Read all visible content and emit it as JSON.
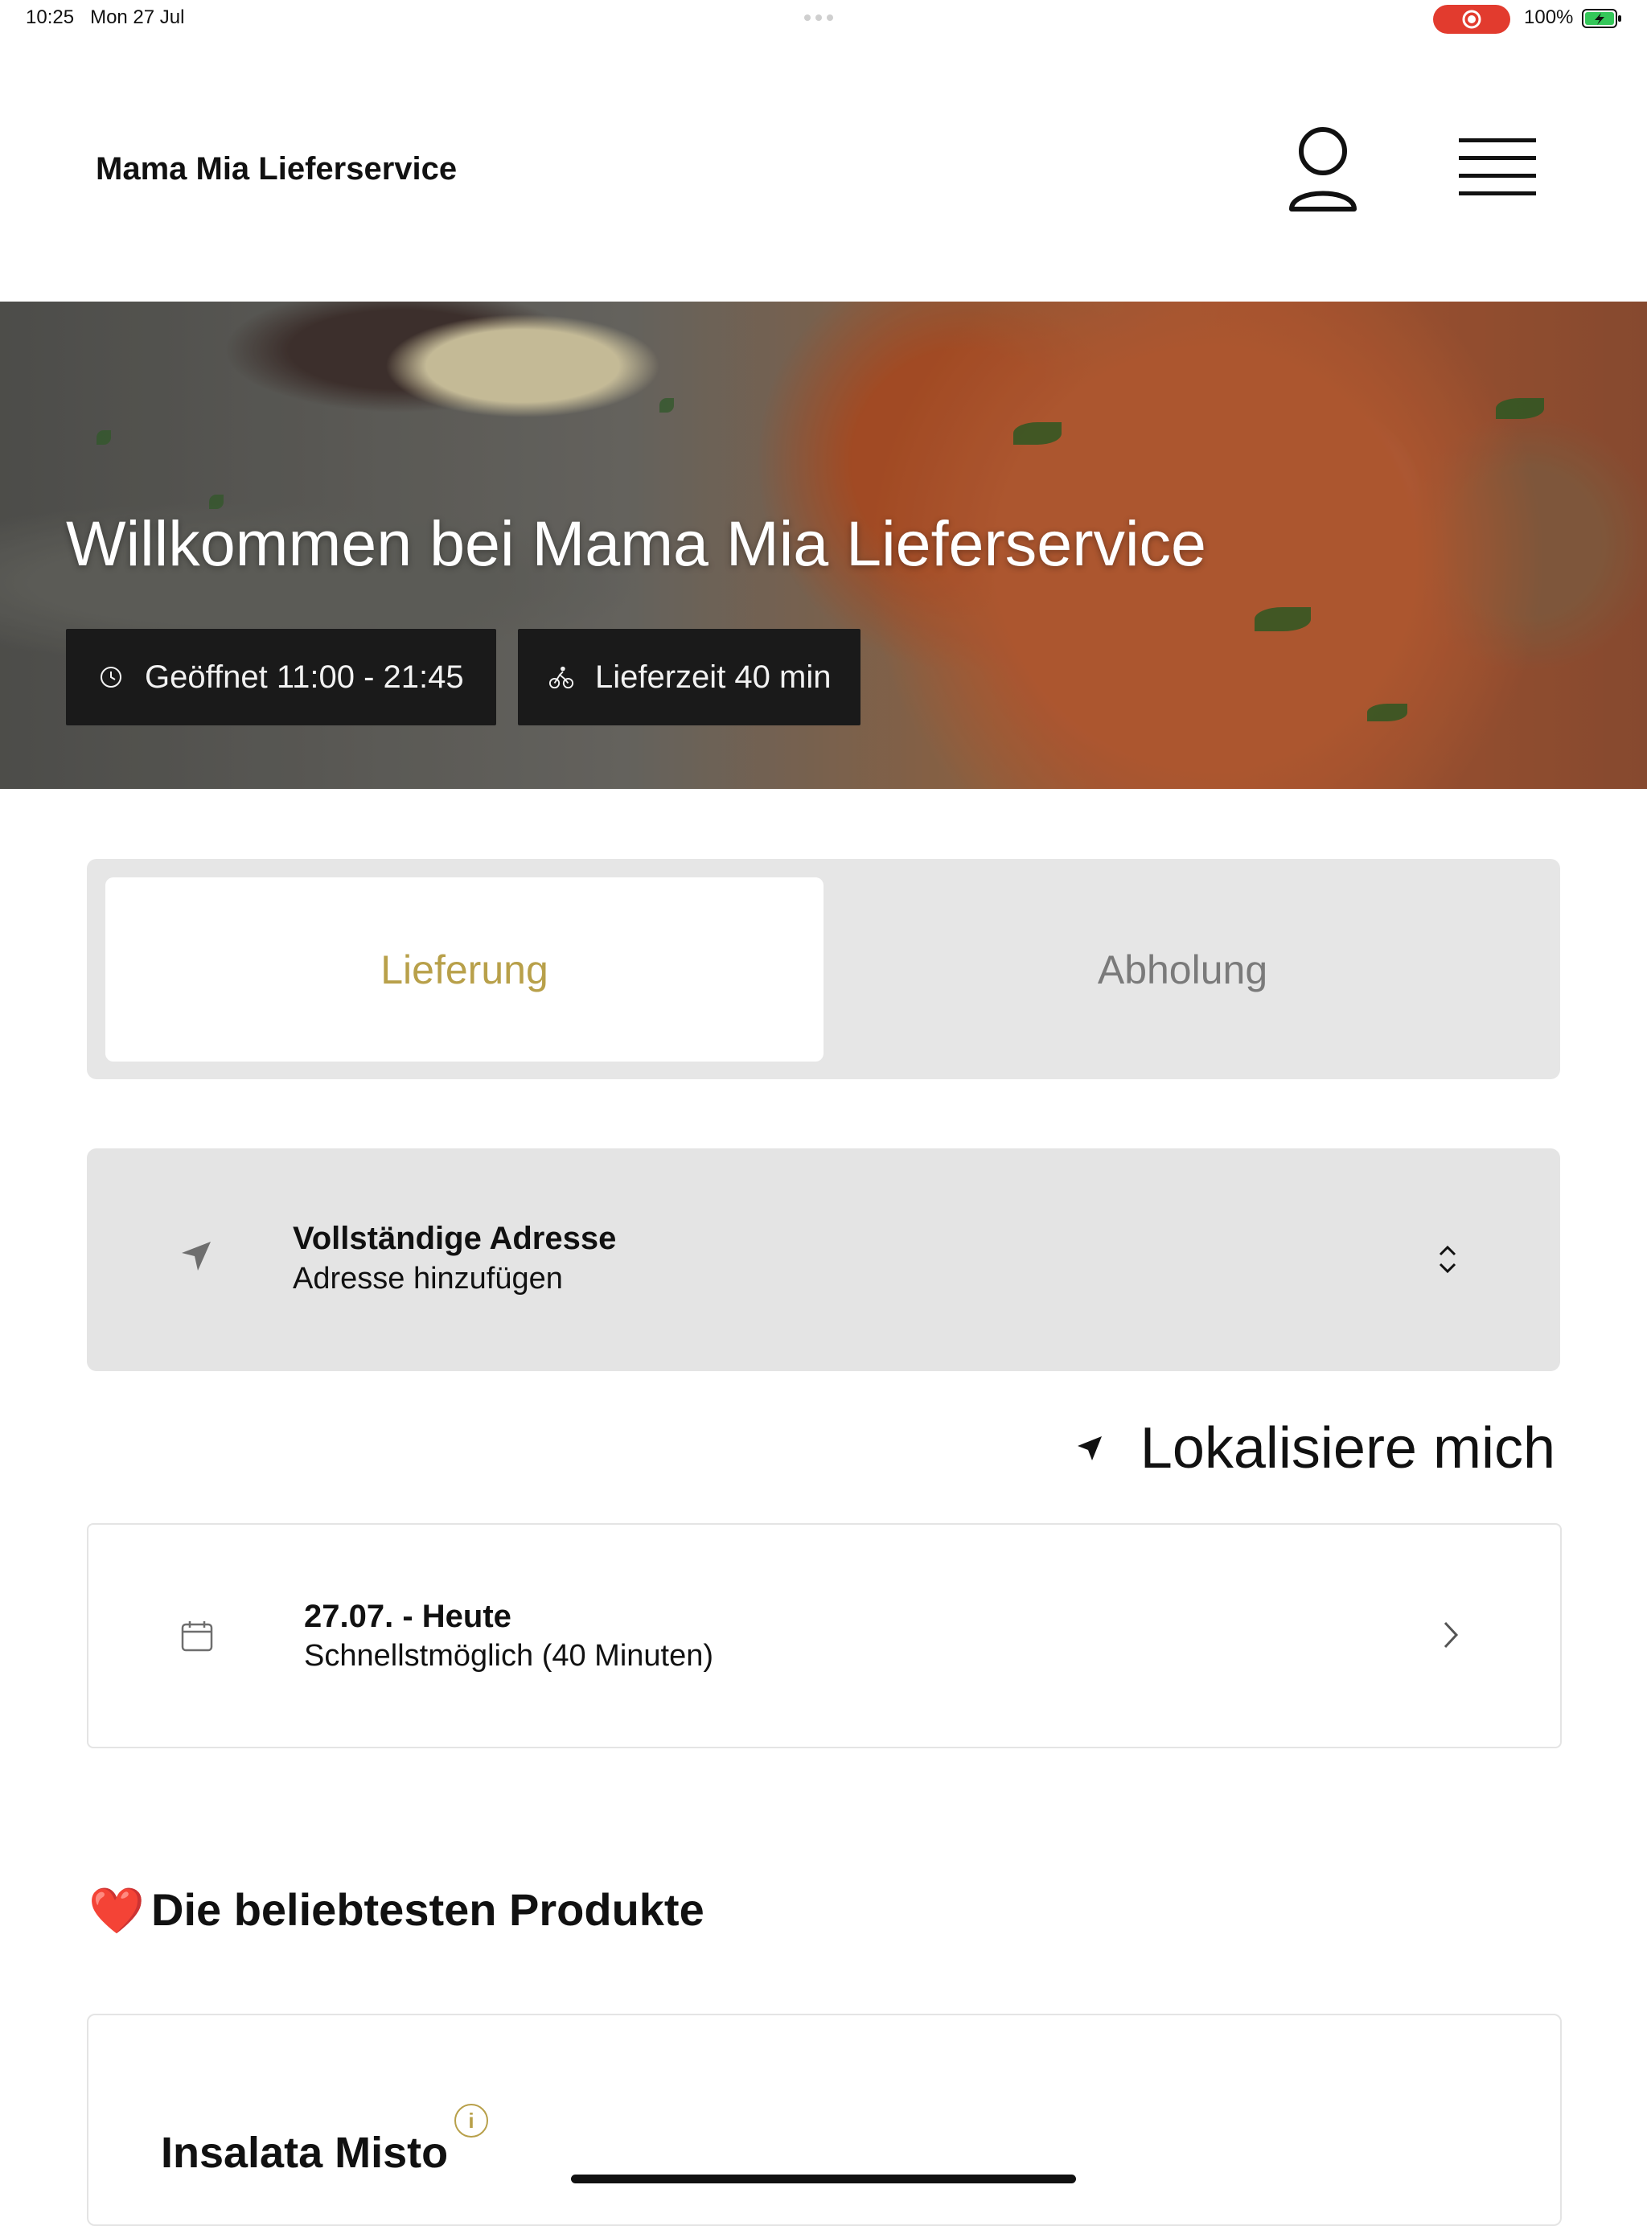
{
  "status_bar": {
    "time": "10:25",
    "date": "Mon 27 Jul",
    "battery": "100%"
  },
  "header": {
    "brand": "Mama Mia Lieferservice",
    "account_icon": "person-icon",
    "menu_icon": "hamburger-menu-icon"
  },
  "hero": {
    "title": "Willkommen bei Mama Mia Lieferservice",
    "hours_label": "Geöffnet 11:00 - 21:45",
    "delivery_label": "Lieferzeit 40 min"
  },
  "order_type": {
    "tabs": [
      "Lieferung",
      "Abholung"
    ],
    "selected": "Lieferung"
  },
  "address": {
    "title": "Vollständige Adresse",
    "subtitle": "Adresse hinzufügen"
  },
  "locate": {
    "label": "Lokalisiere mich"
  },
  "schedule": {
    "title": "27.07. - Heute",
    "subtitle": "Schnellstmöglich (40 Minuten)"
  },
  "popular": {
    "heart": "❤️",
    "title": "Die beliebtesten Produkte"
  },
  "products": [
    {
      "name": "Insalata Misto",
      "info_icon": "info-icon"
    }
  ],
  "colors": {
    "accent": "#b8a04a",
    "chip_bg": "#1a1a1a",
    "panel_bg": "#e6e6e6",
    "record": "#e23b2e"
  }
}
